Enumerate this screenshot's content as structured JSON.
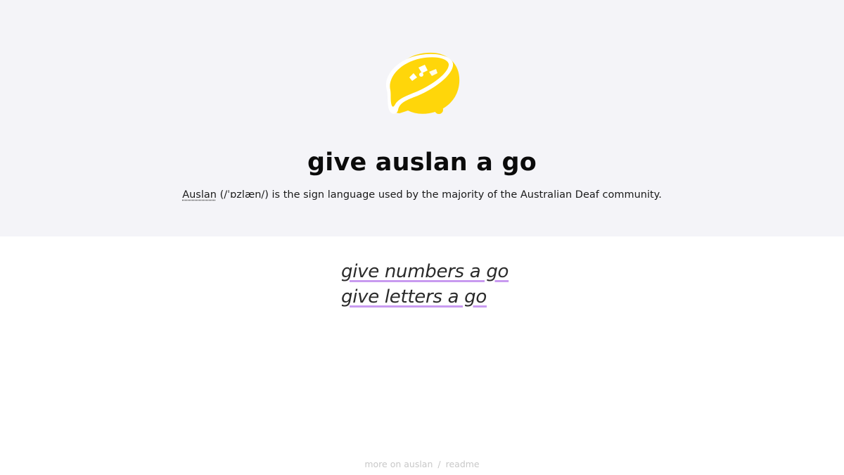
{
  "hero": {
    "title": "give auslan a go",
    "subtitle": {
      "abbr": "Auslan",
      "rest": " (/ˈɒzlæn/) is the sign language used by the majority of the Australian Deaf community."
    },
    "logo_icon": "lemon-icon",
    "background_color": "#f4f4f8"
  },
  "links": [
    {
      "label": "give numbers a go"
    },
    {
      "label": "give letters a go"
    }
  ],
  "link_underline_color": "#c89af0",
  "footer": {
    "more_label": "more on auslan",
    "separator": "/",
    "readme_label": "readme"
  }
}
